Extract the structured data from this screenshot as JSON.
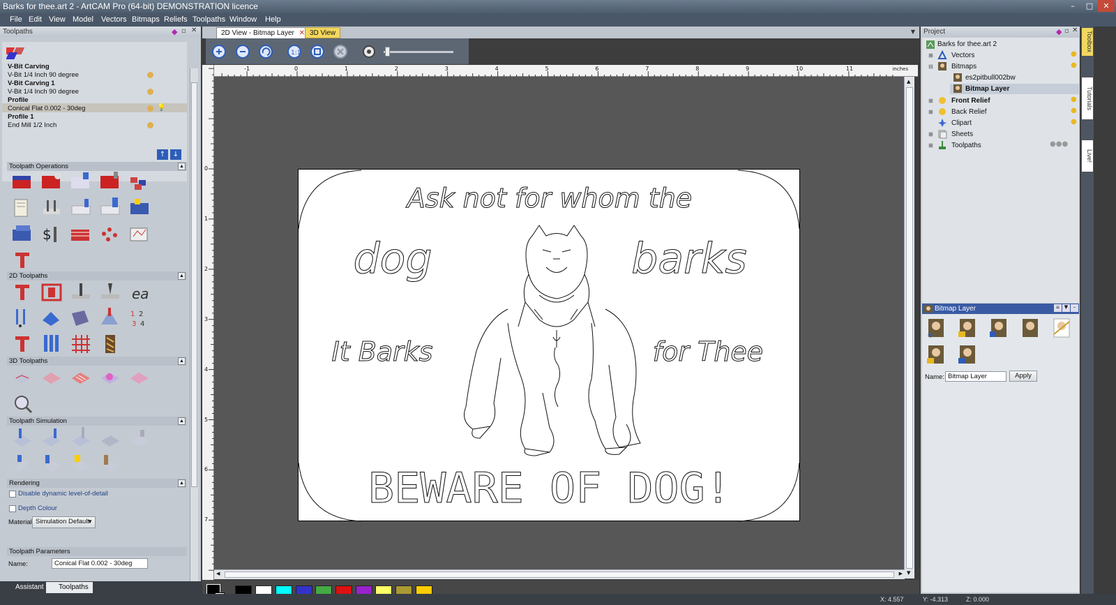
{
  "window": {
    "title": "Barks for thee.art 2 - ArtCAM Pro (64-bit) DEMONSTRATION licence",
    "minimize": "–",
    "maximize": "□",
    "close": "✕"
  },
  "menu": [
    "File",
    "Edit",
    "View",
    "Model",
    "Vectors",
    "Bitmaps",
    "Reliefs",
    "Toolpaths",
    "Window",
    "Help"
  ],
  "left_panel": {
    "title": "Toolpaths",
    "toolpaths": [
      {
        "name": "V-Bit Carving",
        "bold": true
      },
      {
        "name": "V-Bit 1/4 Inch 90 degree",
        "bold": false
      },
      {
        "name": "V-Bit Carving 1",
        "bold": true
      },
      {
        "name": "V-Bit 1/4 Inch 90 degree",
        "bold": false
      },
      {
        "name": "Profile",
        "bold": true
      },
      {
        "name": "Conical Flat 0.002 - 30deg",
        "bold": false
      },
      {
        "name": "Profile 1",
        "bold": true
      },
      {
        "name": "End Mill 1/2 Inch",
        "bold": false
      }
    ],
    "sections": {
      "operations": "Toolpath Operations",
      "toolpaths2d": "2D Toolpaths",
      "toolpaths3d": "3D Toolpaths",
      "simulation": "Toolpath Simulation",
      "rendering": "Rendering",
      "parameters": "Toolpath Parameters"
    },
    "rendering": {
      "dynamic_lod": "Disable dynamic level-of-detail",
      "depth_colour": "Depth Colour",
      "material_label": "Material",
      "material_value": "Simulation Default"
    },
    "params": {
      "name_label": "Name:",
      "name_value": "Conical Flat 0.002 - 30deg"
    },
    "tabs": [
      "Assistant",
      "Toolpaths"
    ]
  },
  "view_tabs": [
    "2D View - Bitmap Layer",
    "3D View"
  ],
  "ruler": {
    "unit": "inches",
    "h_labels": [
      "-1",
      "0",
      "1",
      "2",
      "3",
      "4",
      "5",
      "6",
      "7",
      "8",
      "9",
      "10",
      "11"
    ],
    "v_labels": [
      "0",
      "1",
      "2",
      "3",
      "4",
      "5",
      "6",
      "7"
    ]
  },
  "artwork": {
    "line1": "Ask not for whom the",
    "dog": "dog",
    "barks": "barks",
    "it_barks": "It Barks",
    "for_thee": "for Thee",
    "beware": "BEWARE OF DOG!"
  },
  "palette": [
    "#000000",
    "#ffffff",
    "#00ffff",
    "#3333cc",
    "#44aa44",
    "#dd1111",
    "#9922cc",
    "#ffff66",
    "#aa9933",
    "#ffcc00"
  ],
  "project": {
    "title": "Project",
    "root": "Barks for thee.art 2",
    "nodes": [
      {
        "label": "Vectors",
        "bold": false,
        "level": 1
      },
      {
        "label": "Bitmaps",
        "bold": false,
        "level": 1
      },
      {
        "label": "es2pitbull002bw",
        "bold": false,
        "level": 2
      },
      {
        "label": "Bitmap Layer",
        "bold": true,
        "level": 2
      },
      {
        "label": "Front Relief",
        "bold": true,
        "level": 1
      },
      {
        "label": "Back Relief",
        "bold": false,
        "level": 1
      },
      {
        "label": "Clipart",
        "bold": false,
        "level": 1
      },
      {
        "label": "Sheets",
        "bold": false,
        "level": 1
      },
      {
        "label": "Toolpaths",
        "bold": false,
        "level": 1
      }
    ]
  },
  "bitmap_layer": {
    "title": "Bitmap Layer",
    "name_label": "Name:",
    "name_value": "Bitmap Layer",
    "apply": "Apply"
  },
  "sidebar_tabs": [
    "Toolbox",
    "Tutorials",
    "Live!"
  ],
  "status": {
    "x": "X: 4.557",
    "y": "Y: -4.313",
    "z": "Z: 0.000"
  }
}
